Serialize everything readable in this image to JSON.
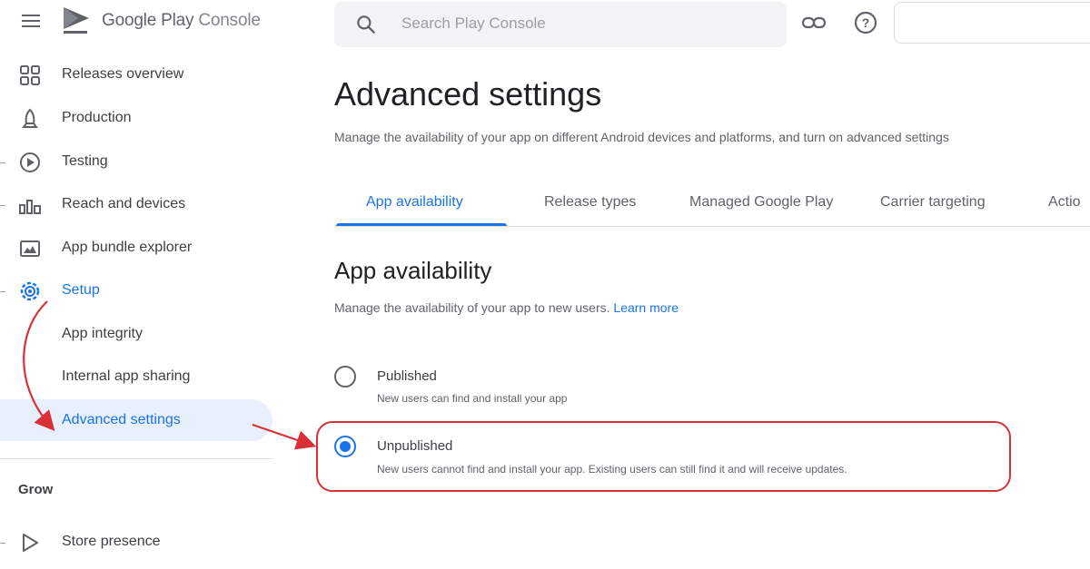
{
  "app": {
    "logo_brand": "Google Play",
    "logo_product": "Console",
    "menu_icon": "hamburger-menu-icon"
  },
  "search": {
    "placeholder": "Search Play Console",
    "icon": "search-icon"
  },
  "toolbar": {
    "icons": [
      "link-icon",
      "help-icon"
    ]
  },
  "sidebar": {
    "items": [
      {
        "label": "Releases overview",
        "icon": "releases-overview-icon"
      },
      {
        "label": "Production",
        "icon": "production-icon"
      },
      {
        "label": "Testing",
        "icon": "testing-icon"
      },
      {
        "label": "Reach and devices",
        "icon": "reach-devices-icon"
      },
      {
        "label": "App bundle explorer",
        "icon": "app-bundle-icon"
      },
      {
        "label": "Setup",
        "icon": "gear-icon"
      },
      {
        "label": "App integrity"
      },
      {
        "label": "Internal app sharing"
      },
      {
        "label": "Advanced settings"
      }
    ],
    "section_grow": "Grow",
    "grow_items": [
      {
        "label": "Store presence",
        "icon": "play-icon"
      }
    ]
  },
  "main": {
    "title": "Advanced settings",
    "subtitle": "Manage the availability of your app on different Android devices and platforms, and turn on advanced settings",
    "tabs": [
      {
        "label": "App availability",
        "active": true
      },
      {
        "label": "Release types"
      },
      {
        "label": "Managed Google Play"
      },
      {
        "label": "Carrier targeting"
      },
      {
        "label": "Actio"
      }
    ],
    "section": {
      "title": "App availability",
      "description": "Manage the availability of your app to new users.",
      "learn_more": "Learn more"
    },
    "options": [
      {
        "label": "Published",
        "description": "New users can find and install your app",
        "selected": false
      },
      {
        "label": "Unpublished",
        "description": "New users cannot find and install your app. Existing users can still find it and will receive updates.",
        "selected": true
      }
    ]
  },
  "colors": {
    "accent": "#1a73e8",
    "annotation": "#d93036",
    "selected_bg": "#e8f0fe"
  }
}
